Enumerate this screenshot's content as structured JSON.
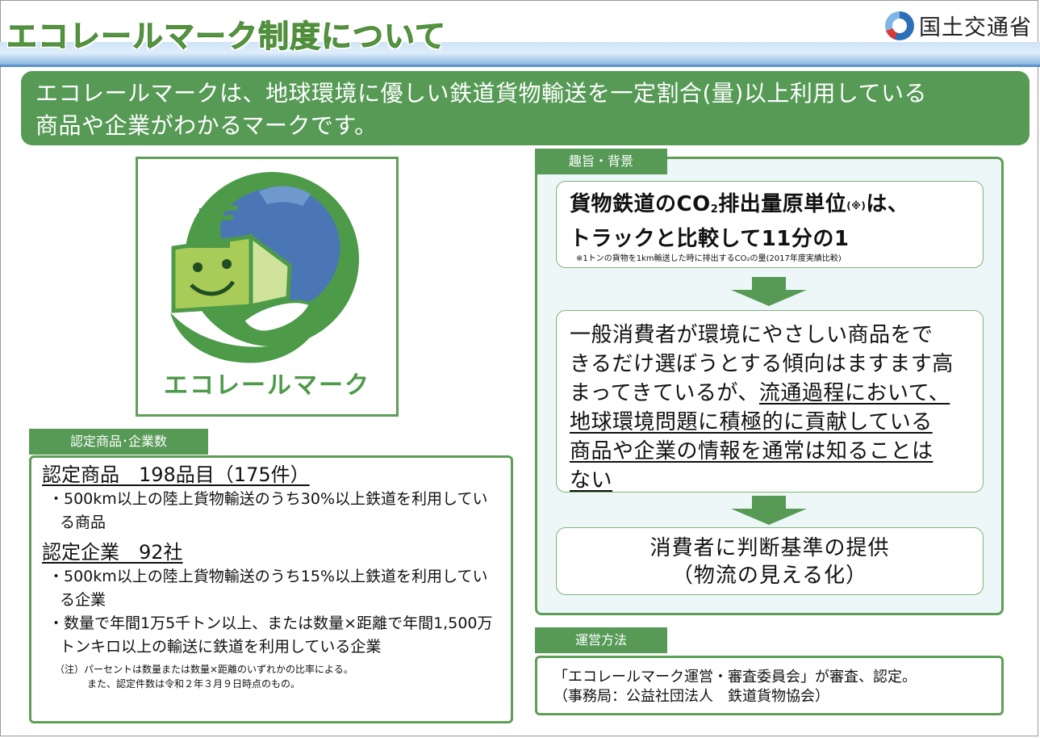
{
  "header": {
    "title": "エコレールマーク制度について",
    "ministry": "国土交通省"
  },
  "banner": {
    "line1": "エコレールマークは、地球環境に優しい鉄道貨物輸送を一定割合(量)以上利用している",
    "line2": "商品や企業がわかるマークです。"
  },
  "logo_mark": {
    "caption": "エコレールマーク"
  },
  "certified": {
    "tab": "認定商品･企業数",
    "products_heading": "認定商品　198品目（175件）",
    "products_items": [
      "・500km以上の陸上貨物輸送のうち30%以上鉄道を利用している商品"
    ],
    "companies_heading": "認定企業　92社",
    "companies_items": [
      "・500km以上の陸上貨物輸送のうち15%以上鉄道を利用している企業",
      "・数量で年間1万5千トン以上、または数量×距離で年間1,500万トンキロ以上の輸送に鉄道を利用している企業"
    ],
    "note_line1": "（注）パーセントは数量または数量×距離のいずれかの比率による。",
    "note_line2": "また、認定件数は令和２年３月９日時点のもの。"
  },
  "purpose": {
    "tab": "趣旨・背景",
    "box1_line1_pre": "貨物鉄道のCO",
    "box1_line1_sub": "2",
    "box1_line1_mid": "排出量原単位",
    "box1_line1_ref": "(※)",
    "box1_line1_post": "は、",
    "box1_line2": "トラックと比較して11分の1",
    "box1_note": "※1トンの貨物を1km輸送した時に排出するCO₂の量(2017年度実績比較)",
    "box2_line1": "一般消費者が環境にやさしい商品をで",
    "box2_line2": "きるだけ選ぼうとする傾向はますます高",
    "box2_line3_plain": "まってきているが、",
    "box2_line3_underlined": "流通過程において、",
    "box2_line4": "地球環境問題に積極的に貢献している",
    "box2_line5": "商品や企業の情報を通常は知ることは",
    "box2_line6": "ない",
    "box3_line1": "消費者に判断基準の提供",
    "box3_line2": "（物流の見える化）"
  },
  "operation": {
    "tab": "運営方法",
    "line1": "「エコレールマーク運営・審査委員会」が審査、認定。",
    "line2": "（事務局：公益社団法人　鉄道貨物協会）"
  },
  "colors": {
    "accent_green": "#569a56",
    "title_green": "#5f9f4a",
    "band_blue": "#5d92c9",
    "panel_bg": "#edf7f7"
  }
}
